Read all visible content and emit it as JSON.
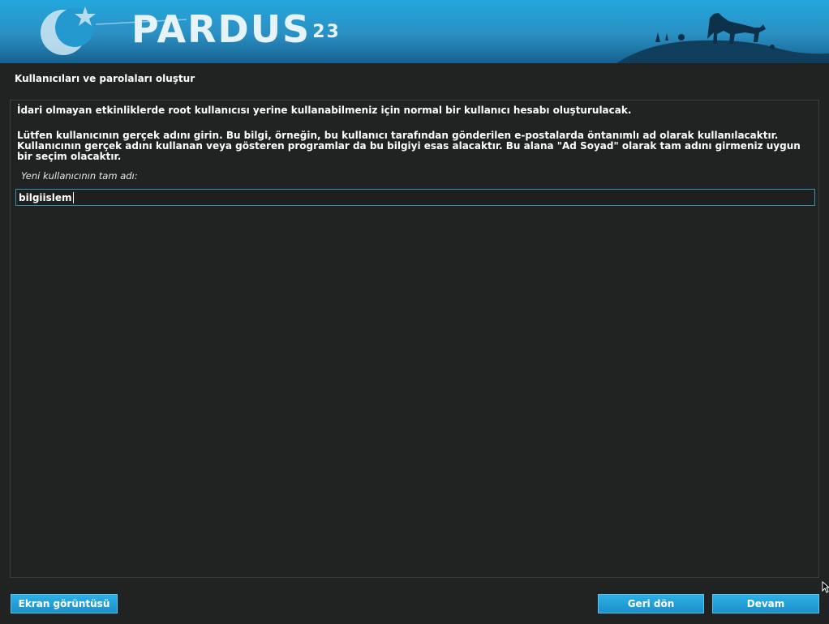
{
  "banner": {
    "logo_text": "PARDUS",
    "version": "23"
  },
  "page": {
    "title": "Kullanıcıları ve parolaları oluştur"
  },
  "content": {
    "intro": "İdari olmayan etkinliklerde root kullanıcısı yerine kullanabilmeniz için normal bir kullanıcı hesabı oluşturulacak.",
    "instructions": "Lütfen kullanıcının gerçek adını girin. Bu bilgi, örneğin, bu kullanıcı tarafından gönderilen e-postalarda öntanımlı ad olarak kullanılacaktır. Kullanıcının gerçek adını kullanan veya gösteren programlar da bu bilgiyi esas alacaktır. Bu alana \"Ad Soyad\" olarak tam adını girmeniz uygun bir seçim olacaktır.",
    "field_label": "Yeni kullanıcının tam adı:",
    "field_value": "bilgiislem"
  },
  "buttons": {
    "screenshot": "Ekran görüntüsü",
    "back": "Geri dön",
    "continue": "Devam"
  },
  "colors": {
    "background": "#202322",
    "banner_top": "#1f9fd6",
    "button": "#1ea0d6",
    "input_border": "#3c8fb0"
  }
}
